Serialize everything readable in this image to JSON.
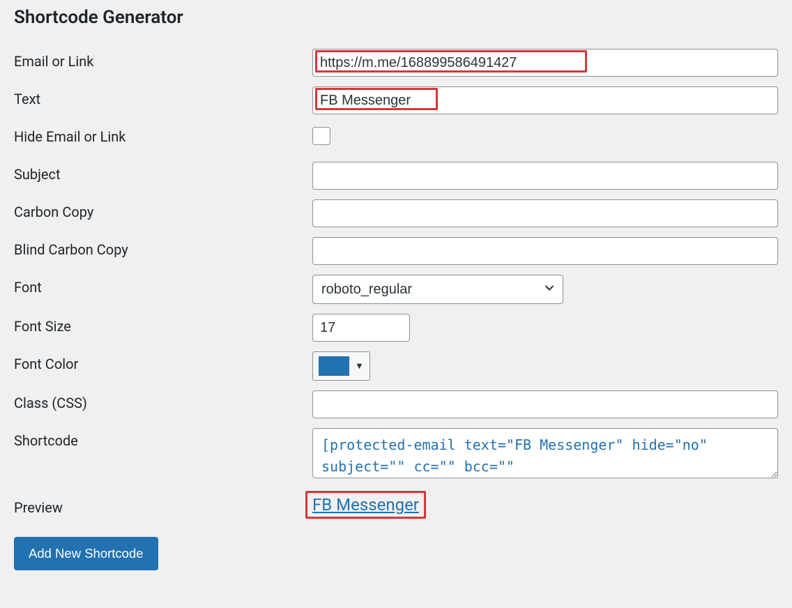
{
  "title": "Shortcode Generator",
  "labels": {
    "email_or_link": "Email or Link",
    "text": "Text",
    "hide": "Hide Email or Link",
    "subject": "Subject",
    "cc": "Carbon Copy",
    "bcc": "Blind Carbon Copy",
    "font": "Font",
    "font_size": "Font Size",
    "font_color": "Font Color",
    "class": "Class (CSS)",
    "shortcode": "Shortcode",
    "preview": "Preview"
  },
  "values": {
    "email_or_link": "https://m.me/168899586491427",
    "text": "FB Messenger",
    "hide_checked": false,
    "subject": "",
    "cc": "",
    "bcc": "",
    "font": "roboto_regular",
    "font_size": "17",
    "font_color": "#2271b1",
    "class": "",
    "shortcode": "[protected-email text=\"FB Messenger\" hide=\"no\" subject=\"\" cc=\"\" bcc=\"\"",
    "preview": "FB Messenger"
  },
  "buttons": {
    "add": "Add New Shortcode"
  }
}
